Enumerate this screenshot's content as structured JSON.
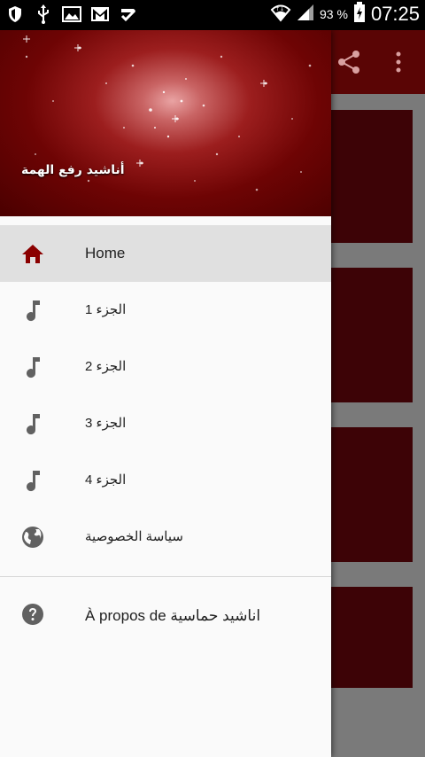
{
  "status_bar": {
    "battery_percent": "93 %",
    "time": "07:25",
    "icons": [
      "shield-icon",
      "usb-icon",
      "image-icon",
      "gmail-icon",
      "checklist-icon",
      "wifi-icon",
      "signal-icon",
      "battery-charging-icon"
    ]
  },
  "app_bar": {
    "actions": [
      "share-icon",
      "more-vert-icon"
    ]
  },
  "drawer": {
    "header_title": "أناشيد رفع الهمة",
    "items": [
      {
        "label": "Home",
        "icon": "home-icon",
        "selected": true
      },
      {
        "label": "الجزء 1",
        "icon": "music-note-icon"
      },
      {
        "label": "الجزء 2",
        "icon": "music-note-icon"
      },
      {
        "label": "الجزء 3",
        "icon": "music-note-icon"
      },
      {
        "label": "الجزء 4",
        "icon": "music-note-icon"
      },
      {
        "label": "سياسة الخصوصية",
        "icon": "globe-icon"
      }
    ],
    "about": {
      "label": "À propos de اناشيد حماسية",
      "icon": "help-icon"
    }
  },
  "colors": {
    "accent": "#8b0000",
    "app_bar": "#5a0505",
    "card": "#3d0306",
    "selected_bg": "#e0e0e0"
  }
}
